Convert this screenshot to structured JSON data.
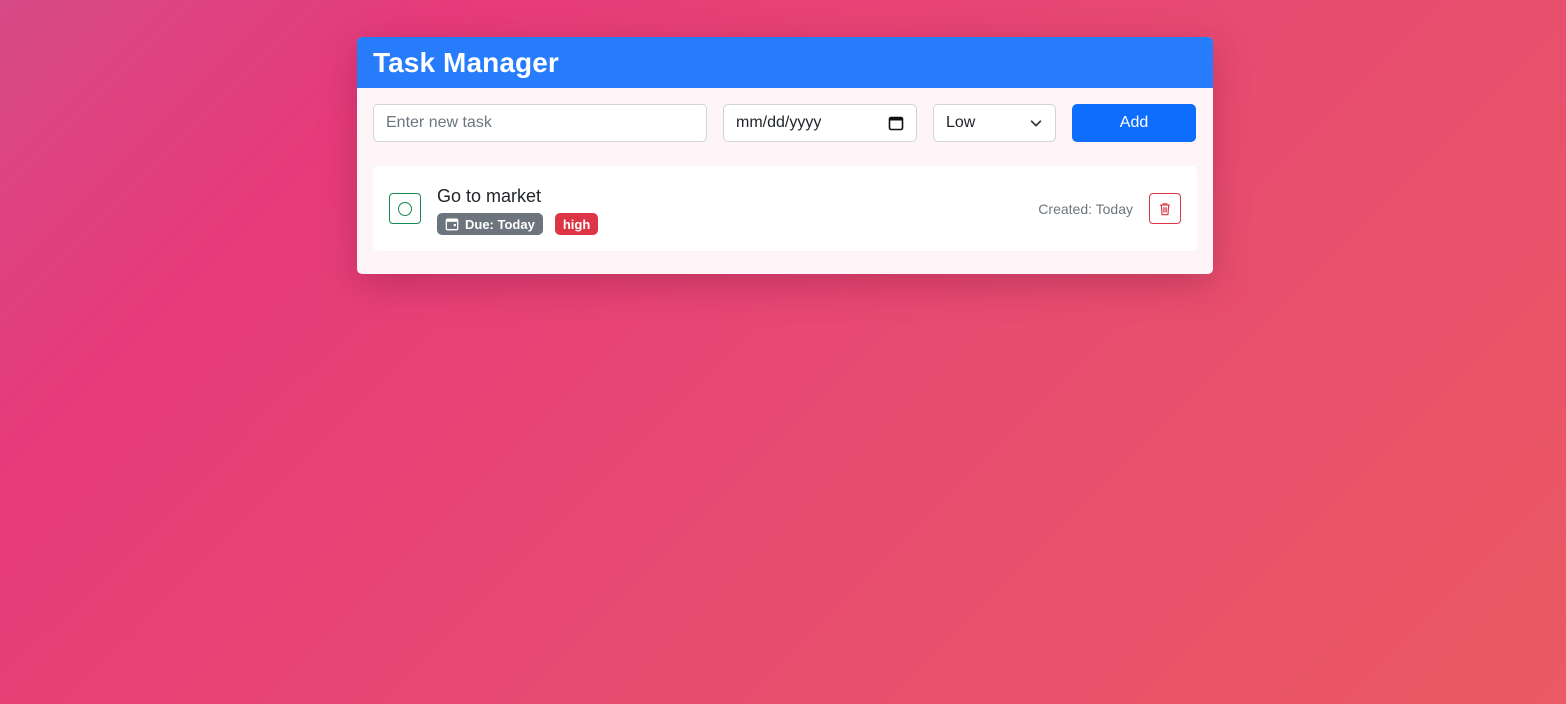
{
  "app": {
    "title": "Task Manager"
  },
  "form": {
    "task_placeholder": "Enter new task",
    "task_value": "",
    "date_placeholder": "mm/dd/yyyy",
    "date_icon": "calendar-icon",
    "priority_selected": "Low",
    "priority_icon": "chevron-down-icon",
    "add_label": "Add"
  },
  "tasks": [
    {
      "title": "Go to market",
      "due_label": "Due: Today",
      "priority": "high",
      "created_label": "Created: Today",
      "completed": false,
      "check_icon": "circle-icon",
      "delete_icon": "trash-icon"
    }
  ],
  "colors": {
    "header": "#267cfb",
    "primary_button": "#0d6efd",
    "success_outline": "#198754",
    "danger": "#dc3545",
    "due_badge": "#6c757d",
    "background_gradient_start": "#e63b7a",
    "background_gradient_end": "#ea5a62"
  }
}
